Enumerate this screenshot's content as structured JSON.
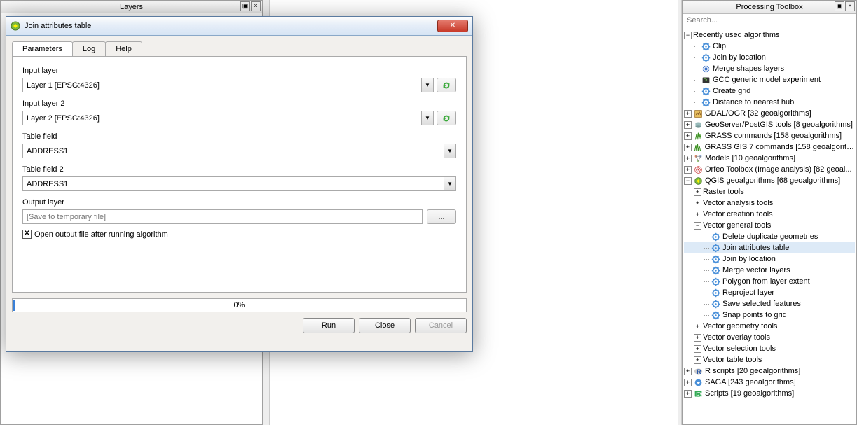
{
  "layers_panel": {
    "title": "Layers"
  },
  "toolbox_panel": {
    "title": "Processing Toolbox",
    "search_placeholder": "Search..."
  },
  "tree": {
    "recent_label": "Recently used algorithms",
    "recent": [
      "Clip",
      "Join by location",
      "Merge shapes layers",
      "GCC generic model experiment",
      "Create grid",
      "Distance to nearest hub"
    ],
    "providers": [
      {
        "label": "GDAL/OGR [32 geoalgorithms]",
        "icon": "gdal"
      },
      {
        "label": "GeoServer/PostGIS tools [8 geoalgorithms]",
        "icon": "geo"
      },
      {
        "label": "GRASS commands [158 geoalgorithms]",
        "icon": "grass"
      },
      {
        "label": "GRASS GIS 7 commands [158 geoalgorith...",
        "icon": "grass"
      },
      {
        "label": "Models [10 geoalgorithms]",
        "icon": "model"
      },
      {
        "label": "Orfeo Toolbox (Image analysis) [82 geoal...",
        "icon": "otb"
      }
    ],
    "qgis_label": "QGIS geoalgorithms [68 geoalgorithms]",
    "qgis_groups_before": [
      "Raster tools",
      "Vector analysis tools",
      "Vector creation tools"
    ],
    "vgt_label": "Vector general tools",
    "vgt_items": [
      "Delete duplicate geometries",
      "Join attributes table",
      "Join by location",
      "Merge vector layers",
      "Polygon from layer extent",
      "Reproject layer",
      "Save selected features",
      "Snap points to grid"
    ],
    "vgt_selected": "Join attributes table",
    "qgis_groups_after": [
      "Vector geometry tools",
      "Vector overlay tools",
      "Vector selection tools",
      "Vector table tools"
    ],
    "after_providers": [
      {
        "label": "R scripts [20 geoalgorithms]",
        "icon": "r"
      },
      {
        "label": "SAGA [243 geoalgorithms]",
        "icon": "saga"
      },
      {
        "label": "Scripts [19 geoalgorithms]",
        "icon": "script"
      }
    ]
  },
  "dialog": {
    "title": "Join attributes table",
    "tabs": {
      "params": "Parameters",
      "log": "Log",
      "help": "Help"
    },
    "labels": {
      "input_layer": "Input layer",
      "input_layer2": "Input layer 2",
      "table_field": "Table field",
      "table_field2": "Table field 2",
      "output_layer": "Output layer",
      "open_after": "Open output file after running algorithm"
    },
    "values": {
      "input_layer": "Layer 1 [EPSG:4326]",
      "input_layer2": "Layer 2 [EPSG:4326]",
      "table_field": "ADDRESS1",
      "table_field2": "ADDRESS1",
      "output_placeholder": "[Save to temporary file]",
      "checkbox_checked": true
    },
    "browse_label": "...",
    "progress": "0%",
    "buttons": {
      "run": "Run",
      "close": "Close",
      "cancel": "Cancel"
    }
  }
}
